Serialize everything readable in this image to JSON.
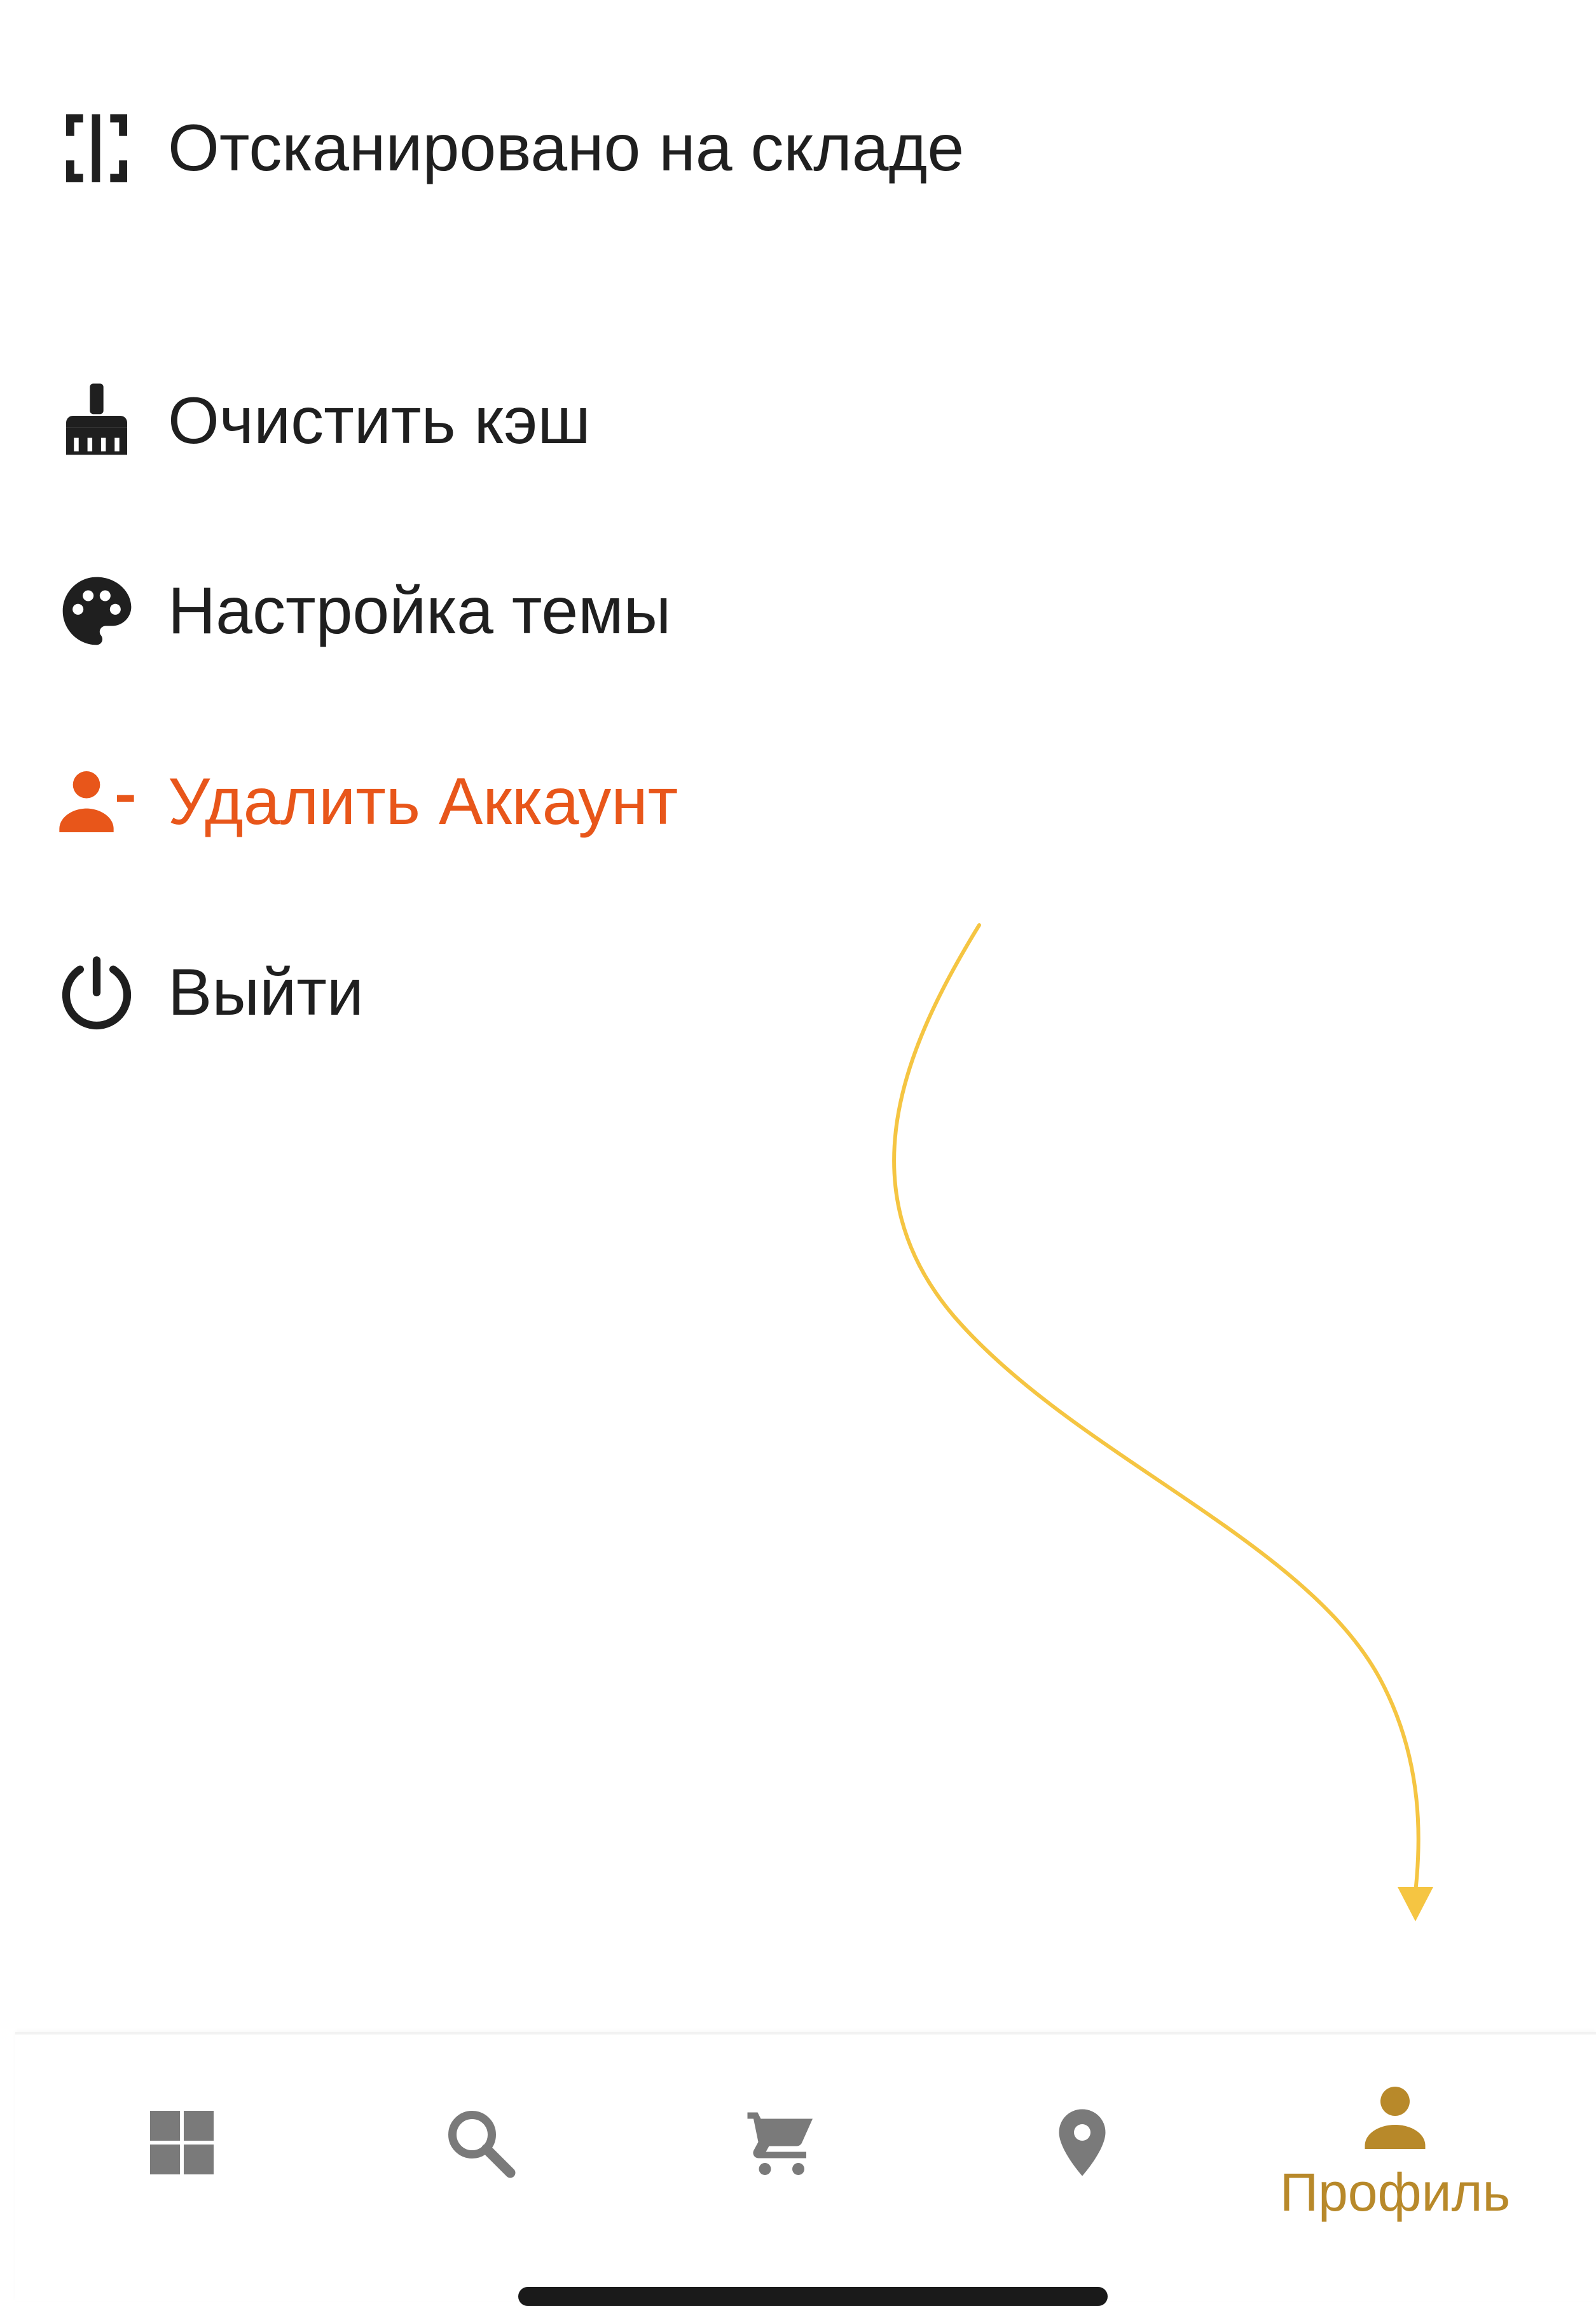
{
  "menu": {
    "items": [
      {
        "id": "scan",
        "label": "Отсканировано на складе",
        "icon": "scan-frame-icon"
      },
      {
        "id": "clear",
        "label": "Очистить кэш",
        "icon": "broom-icon"
      },
      {
        "id": "theme",
        "label": "Настройка темы",
        "icon": "palette-icon"
      },
      {
        "id": "delete",
        "label": "Удалить Аккаунт",
        "icon": "remove-user-icon",
        "color": "#e8561a"
      },
      {
        "id": "logout",
        "label": "Выйти",
        "icon": "power-icon"
      }
    ]
  },
  "bottom_nav": {
    "items": [
      {
        "id": "catalog",
        "icon": "grid-icon"
      },
      {
        "id": "search",
        "icon": "search-icon"
      },
      {
        "id": "cart",
        "icon": "cart-icon"
      },
      {
        "id": "location",
        "icon": "location-pin-icon"
      },
      {
        "id": "profile",
        "icon": "person-icon",
        "label": "Профиль",
        "active": true
      }
    ],
    "active_color": "#b8892a",
    "inactive_color": "#7a7a7a"
  },
  "annotation": {
    "arrow_color": "#f5c542"
  }
}
